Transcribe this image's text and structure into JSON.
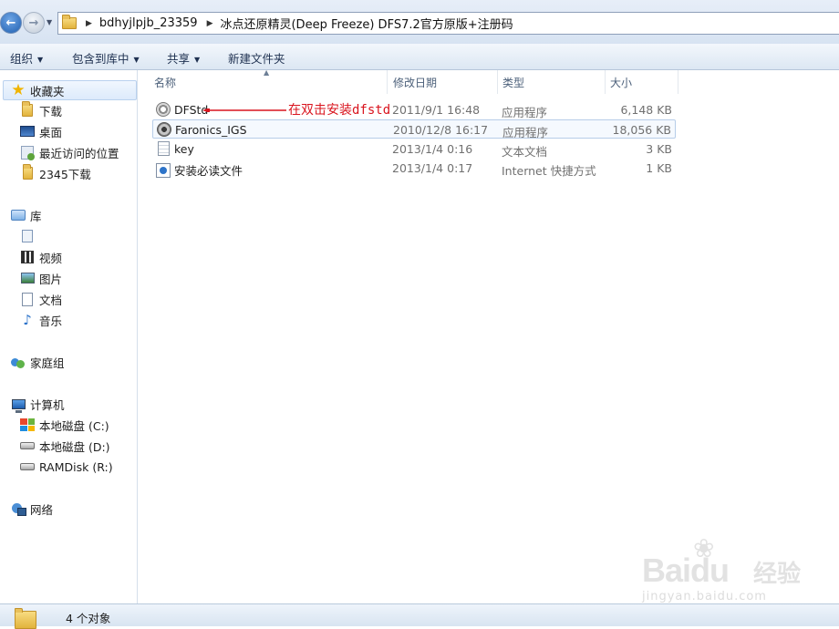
{
  "address_bar": {
    "breadcrumbs": [
      "bdhyjlpjb_23359",
      "冰点还原精灵(Deep Freeze) DFS7.2官方原版+注册码"
    ]
  },
  "toolbar": {
    "organize": "组织",
    "include_in_library": "包含到库中",
    "share": "共享",
    "new_folder": "新建文件夹"
  },
  "nav": {
    "favorites": "收藏夹",
    "downloads": "下载",
    "desktop": "桌面",
    "recent": "最近访问的位置",
    "downloads_2345": "2345下载",
    "libraries": "库",
    "videos": "视频",
    "pictures": "图片",
    "documents": "文档",
    "music": "音乐",
    "homegroup": "家庭组",
    "computer": "计算机",
    "drive_c": "本地磁盘 (C:)",
    "drive_d": "本地磁盘 (D:)",
    "drive_r": "RAMDisk (R:)",
    "network": "网络"
  },
  "columns": {
    "name": "名称",
    "date": "修改日期",
    "type": "类型",
    "size": "大小"
  },
  "files": [
    {
      "name": "DFStd",
      "date": "2011/9/1 16:48",
      "type": "应用程序",
      "size": "6,148 KB",
      "icon": "setup-icon"
    },
    {
      "name": "Faronics_IGS",
      "date": "2010/12/8 16:17",
      "type": "应用程序",
      "size": "18,056 KB",
      "icon": "setup-icon"
    },
    {
      "name": "key",
      "date": "2013/1/4 0:16",
      "type": "文本文档",
      "size": "3 KB",
      "icon": "text-file-icon"
    },
    {
      "name": "安装必读文件",
      "date": "2013/1/4 0:17",
      "type": "Internet 快捷方式",
      "size": "1 KB",
      "icon": "internet-shortcut-icon"
    }
  ],
  "annotation": {
    "text": "在双击安装dfstd",
    "color": "#d9141e"
  },
  "watermark": {
    "logo": "Baidu",
    "brand": "经验",
    "url": "jingyan.baidu.com"
  },
  "status": {
    "text": "4 个对象"
  },
  "colors": {
    "accent": "#1f5fb0",
    "selection_border": "#b7cde8",
    "annotation": "#d9141e"
  }
}
